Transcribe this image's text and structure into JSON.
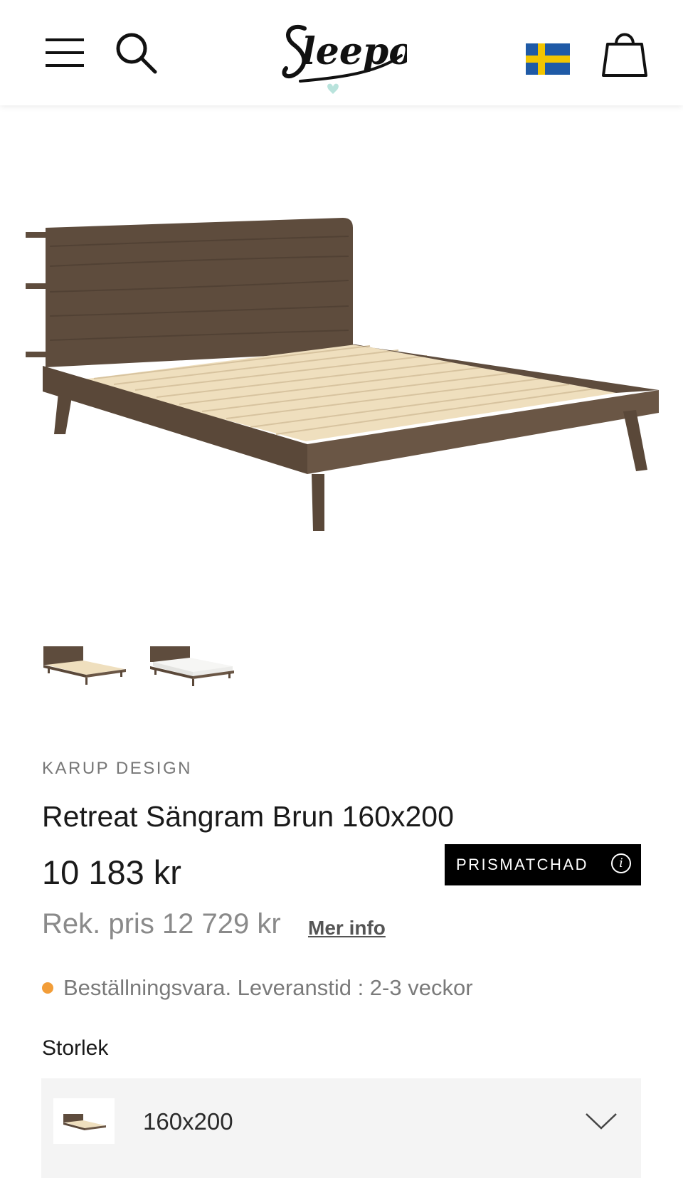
{
  "header": {
    "menu_icon": "hamburger-menu-icon",
    "search_icon": "search-icon",
    "logo_text": "Sleepo",
    "flag_icon": "swedish-flag-icon",
    "cart_icon": "shopping-bag-icon"
  },
  "gallery": {
    "thumbnails": [
      "bed-frame-thumbnail",
      "bed-with-mattress-thumbnail"
    ]
  },
  "product": {
    "brand": "KARUP DESIGN",
    "title": "Retreat Sängram Brun 160x200",
    "price": "10 183 kr",
    "badge_label": "PRISMATCHAD",
    "badge_icon": "info-icon",
    "recommended_price": "Rek. pris 12 729 kr",
    "more_info_link": "Mer info",
    "availability": "Beställningsvara. Leveranstid : 2-3 veckor",
    "availability_color": "#f29d38"
  },
  "size": {
    "label": "Storlek",
    "selected": "160x200"
  },
  "colors": {
    "wood": "#5e4c3d",
    "slats": "#efdfbe",
    "badge_bg": "#000000"
  }
}
